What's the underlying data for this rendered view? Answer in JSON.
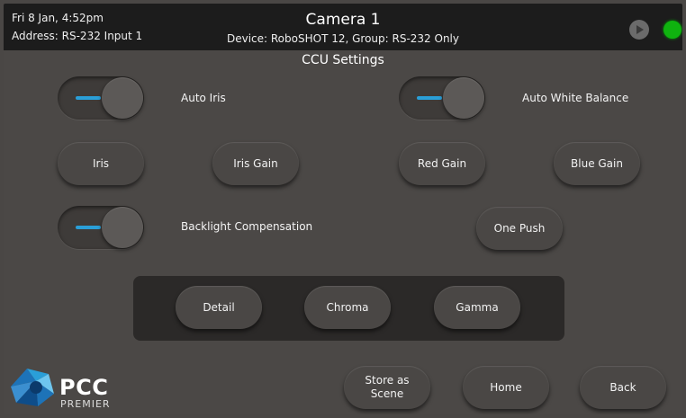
{
  "header": {
    "datetime": "Fri 8 Jan, 4:52pm",
    "address": "Address: RS-232 Input 1",
    "title": "Camera 1",
    "device": "Device: RoboSHOT 12, Group: RS-232 Only"
  },
  "section_title": "CCU Settings",
  "toggles": {
    "auto_iris": {
      "label": "Auto Iris",
      "on": true
    },
    "auto_white_balance": {
      "label": "Auto White Balance",
      "on": true
    },
    "backlight": {
      "label": "Backlight Compensation",
      "on": true
    }
  },
  "buttons": {
    "iris": "Iris",
    "iris_gain": "Iris Gain",
    "red_gain": "Red Gain",
    "blue_gain": "Blue Gain",
    "one_push": "One Push",
    "detail": "Detail",
    "chroma": "Chroma",
    "gamma": "Gamma",
    "store_scene": "Store as\nScene",
    "home": "Home",
    "back": "Back"
  },
  "logo": {
    "name": "PCC",
    "sub": "PREMIER"
  },
  "colors": {
    "accent": "#2a9fd8",
    "status_led": "#0fb30f",
    "topbar": "#1c1c1c",
    "background": "#4a4745"
  }
}
